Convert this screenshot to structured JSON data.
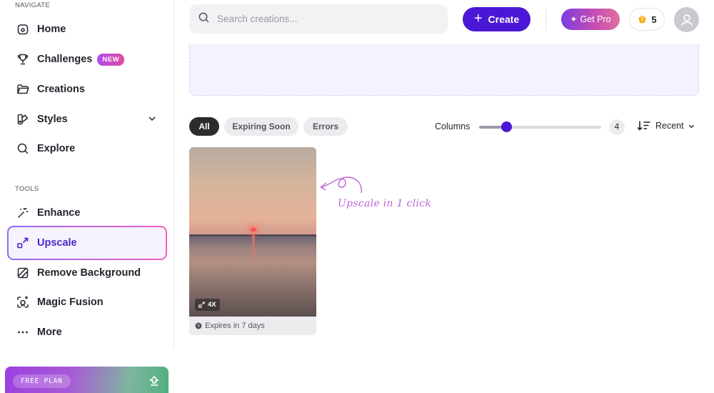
{
  "sidebar": {
    "navigate_label": "NAVIGATE",
    "tools_label": "TOOLS",
    "nav_items": [
      {
        "label": "Home",
        "icon": "home-icon"
      },
      {
        "label": "Challenges",
        "icon": "trophy-icon",
        "badge": "NEW"
      },
      {
        "label": "Creations",
        "icon": "folder-icon"
      },
      {
        "label": "Styles",
        "icon": "palette-icon"
      },
      {
        "label": "Explore",
        "icon": "search-icon"
      }
    ],
    "tool_items": [
      {
        "label": "Enhance",
        "icon": "magic-wand-icon"
      },
      {
        "label": "Upscale",
        "icon": "upscale-icon",
        "active": true
      },
      {
        "label": "Remove Background",
        "icon": "remove-bg-icon"
      },
      {
        "label": "Magic Fusion",
        "icon": "magic-fusion-icon"
      },
      {
        "label": "More",
        "icon": "more-icon"
      }
    ],
    "plan": {
      "label": "FREE PLAN",
      "icon": "upgrade-arrow-icon"
    }
  },
  "header": {
    "search_placeholder": "Search creations...",
    "create_label": "Create",
    "pro_label": "Get Pro",
    "credits": "5"
  },
  "filters": {
    "chips": [
      "All",
      "Expiring Soon",
      "Errors"
    ],
    "active_chip": "All",
    "columns_label": "Columns",
    "columns_value": "4",
    "columns_fraction": 0.22,
    "sort_label": "Recent"
  },
  "card": {
    "badge": "4X",
    "expires": "Expires in 7 days"
  },
  "hint": "Upscale in 1 click",
  "colors": {
    "accent": "#4a17d6",
    "active_text": "#4e22c6",
    "hint": "#c063d8"
  }
}
